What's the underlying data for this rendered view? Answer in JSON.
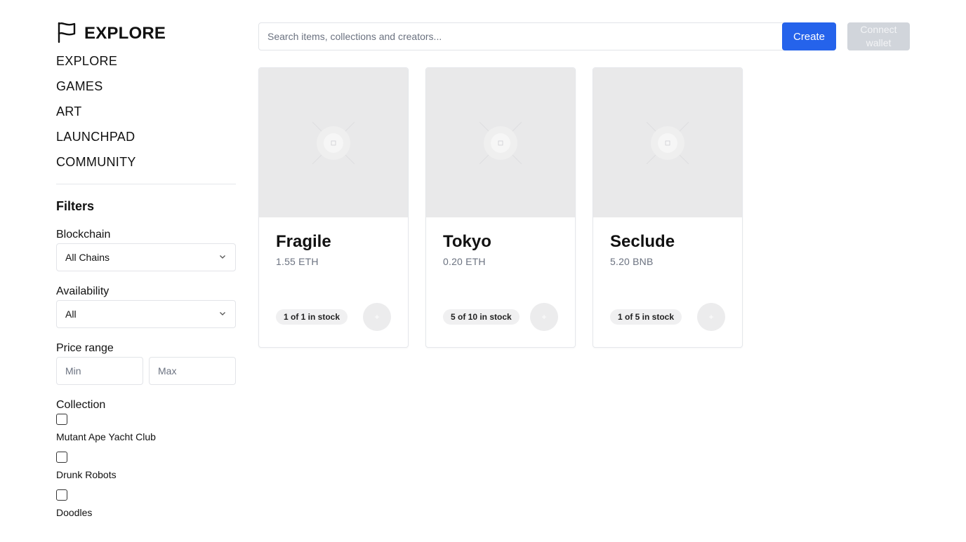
{
  "brand": {
    "title": "EXPLORE",
    "icon": "flag-icon"
  },
  "nav": [
    {
      "label": "EXPLORE"
    },
    {
      "label": "GAMES"
    },
    {
      "label": "ART"
    },
    {
      "label": "LAUNCHPAD"
    },
    {
      "label": "COMMUNITY"
    }
  ],
  "filters": {
    "title": "Filters",
    "blockchain": {
      "label": "Blockchain",
      "value": "All Chains"
    },
    "availability": {
      "label": "Availability",
      "value": "All"
    },
    "price_range": {
      "label": "Price range",
      "min_placeholder": "Min",
      "max_placeholder": "Max"
    },
    "collection": {
      "label": "Collection",
      "items": [
        {
          "label": "Mutant Ape Yacht Club",
          "checked": false
        },
        {
          "label": "Drunk Robots",
          "checked": false
        },
        {
          "label": "Doodles",
          "checked": false
        }
      ]
    }
  },
  "topbar": {
    "search_placeholder": "Search items, collections and creators...",
    "create_label": "Create",
    "connect_label": "Connect wallet"
  },
  "cards": [
    {
      "title": "Fragile",
      "price": "1.55 ETH",
      "stock": "1 of 1 in stock"
    },
    {
      "title": "Tokyo",
      "price": "0.20 ETH",
      "stock": "5 of 10 in stock"
    },
    {
      "title": "Seclude",
      "price": "5.20 BNB",
      "stock": "1 of 5 in stock"
    }
  ],
  "colors": {
    "accent": "#2563eb",
    "disabled": "#d1d5db",
    "placeholder_bg": "#e9e9ea"
  }
}
